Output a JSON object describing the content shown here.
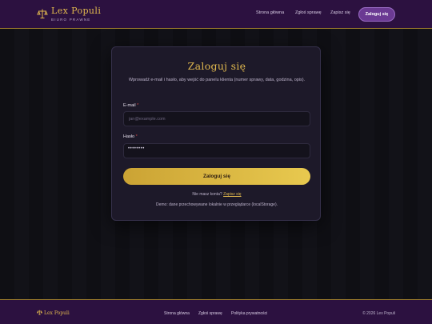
{
  "brand": {
    "name": "Lex Populi",
    "subtitle": "BIURO PRAWNE"
  },
  "nav": {
    "home": "Strona główna",
    "report": "Zgłoś sprawę",
    "contact": "Zapisz się",
    "login": "Zaloguj się"
  },
  "login_card": {
    "title": "Zaloguj się",
    "description": "Wprowadź e-mail i hasło, aby wejść do panelu klienta (numer sprawy, data, godzina, opis).",
    "email_label": "E-mail",
    "email_placeholder": "jan@example.com",
    "password_label": "Hasło",
    "password_value": "••••••••",
    "required_mark": "*",
    "submit_label": "Zaloguj się",
    "signup_prompt": "Nie masz konta?",
    "signup_link": "Zapisz się",
    "demo_note": "Demo: dane przechowywane lokalnie w przeglądarce (localStorage)."
  },
  "footer": {
    "brand": "Lex Populi",
    "links": [
      "Strona główna",
      "Zgłoś sprawę",
      "Polityka prywatności"
    ],
    "copyright": "© 2026 Lex Populi"
  },
  "colors": {
    "accent_gold": "#e0b84e",
    "header_bg": "#2c1140",
    "card_bg": "#1d1929"
  },
  "icons": {
    "logo": "scales-icon"
  }
}
